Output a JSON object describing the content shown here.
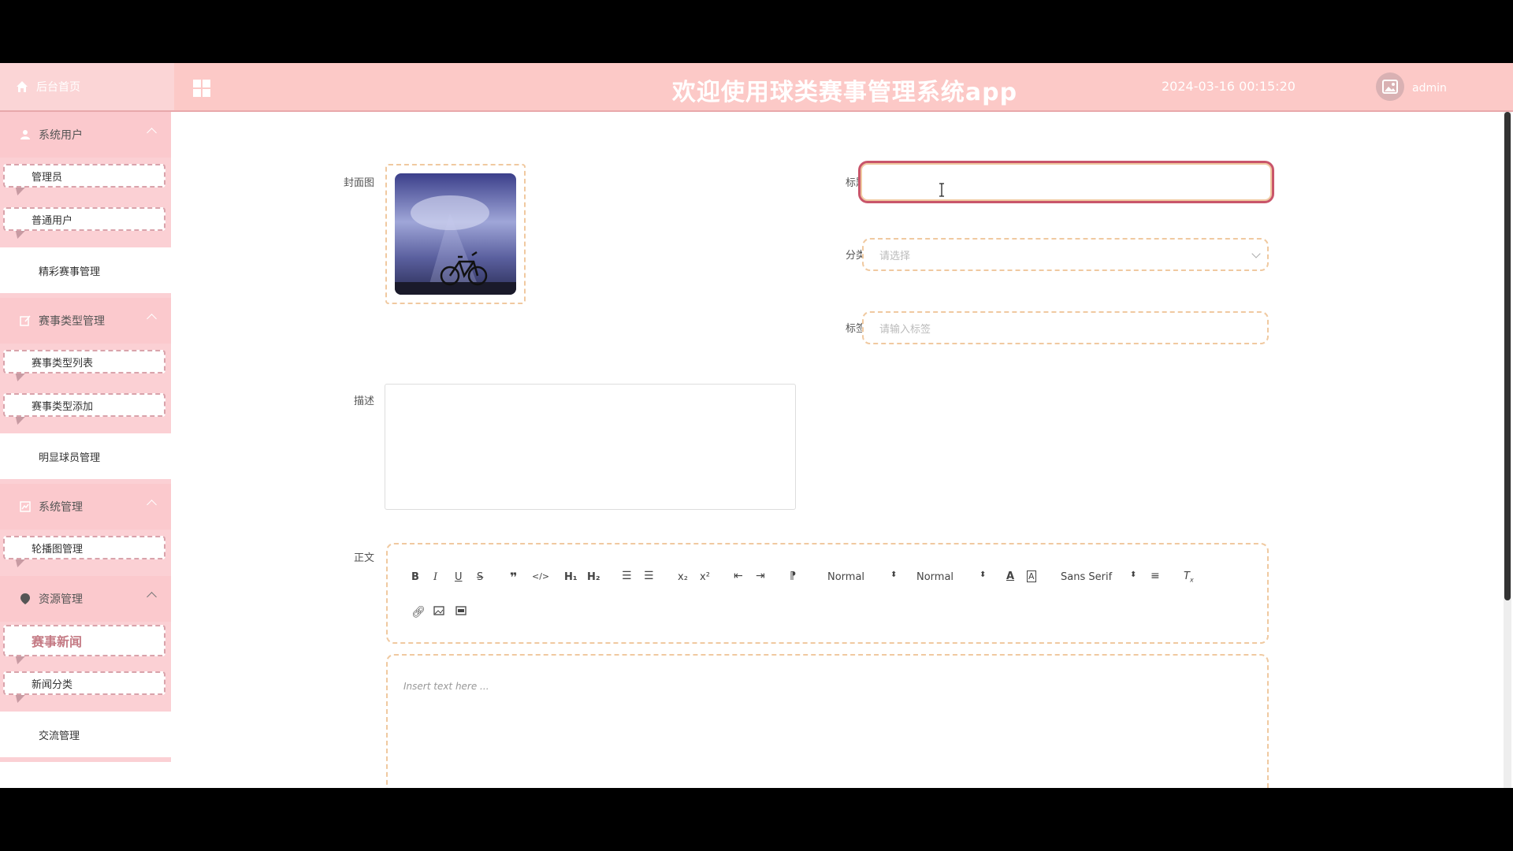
{
  "header": {
    "home_label": "后台首页",
    "title": "欢迎使用球类赛事管理系统app",
    "datetime": "2024-03-16 00:15:20",
    "username": "admin"
  },
  "sidebar": {
    "groups": [
      {
        "label": "系统用户",
        "items": [
          "管理员",
          "普通用户"
        ]
      },
      {
        "label": "精彩赛事管理"
      },
      {
        "label": "赛事类型管理",
        "items": [
          "赛事类型列表",
          "赛事类型添加"
        ]
      },
      {
        "label": "明显球员管理"
      },
      {
        "label": "系统管理",
        "items": [
          "轮播图管理"
        ]
      },
      {
        "label": "资源管理",
        "items": [
          "赛事新闻",
          "新闻分类"
        ],
        "active": "赛事新闻"
      },
      {
        "label": "交流管理"
      }
    ]
  },
  "form": {
    "cover_label": "封面图",
    "title_label": "标题",
    "category_label": "分类",
    "category_placeholder": "请选择",
    "tags_label": "标签",
    "tags_placeholder": "请输入标签",
    "description_label": "描述",
    "body_label": "正文",
    "editor_placeholder": "Insert text here ...",
    "toolbar": {
      "size_select": "Normal",
      "header_select": "Normal",
      "font_select": "Sans Serif"
    }
  },
  "colors": {
    "header_bg": "#fcc9c7",
    "group_bg": "#fbc9cd",
    "accent": "#c9556a"
  }
}
